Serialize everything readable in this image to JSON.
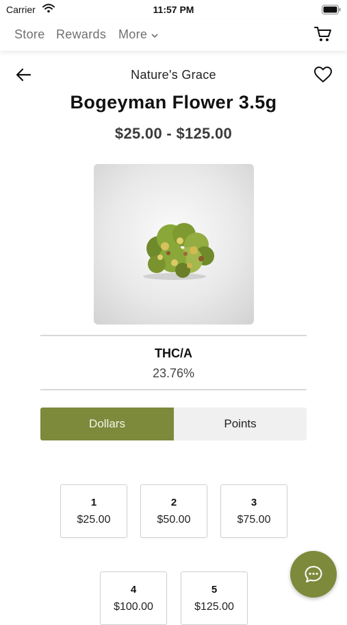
{
  "status_bar": {
    "carrier": "Carrier",
    "time": "11:57 PM"
  },
  "nav": {
    "store": "Store",
    "rewards": "Rewards",
    "more": "More"
  },
  "product": {
    "brand": "Nature's Grace",
    "name": "Bogeyman Flower 3.5g",
    "price_range": "$25.00 - $125.00",
    "thc_label": "THC/A",
    "thc_value": "23.76%"
  },
  "currency_toggle": {
    "dollars": "Dollars",
    "points": "Points",
    "selected": "Dollars"
  },
  "options": [
    {
      "qty": "1",
      "price": "$25.00"
    },
    {
      "qty": "2",
      "price": "$50.00"
    },
    {
      "qty": "3",
      "price": "$75.00"
    },
    {
      "qty": "4",
      "price": "$100.00"
    },
    {
      "qty": "5",
      "price": "$125.00"
    }
  ],
  "colors": {
    "accent": "#7d8a3c",
    "toggle_bg": "#f0f0f0",
    "divider": "#d8d8d8"
  },
  "icons": {
    "wifi": "wifi-icon",
    "battery": "battery-icon",
    "cart": "cart-icon",
    "back": "arrow-left-icon",
    "favorite": "heart-icon",
    "chat": "chat-bubble-icon",
    "more": "chevron-down-icon"
  }
}
